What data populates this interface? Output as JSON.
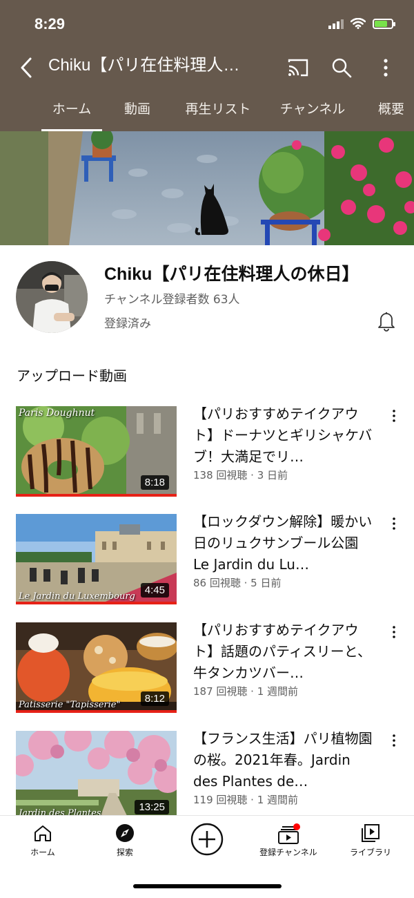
{
  "status": {
    "time": "8:29"
  },
  "appbar": {
    "title": "Chiku【パリ在住料理人…",
    "icons": [
      "back-icon",
      "cast-icon",
      "search-icon",
      "more-vert-icon"
    ]
  },
  "tabs": [
    {
      "label": "ホーム",
      "active": true
    },
    {
      "label": "動画",
      "active": false
    },
    {
      "label": "再生リスト",
      "active": false
    },
    {
      "label": "チャンネル",
      "active": false
    },
    {
      "label": "概要",
      "active": false
    }
  ],
  "channel": {
    "name": "Chiku【パリ在住料理人の休日】",
    "subscribers": "チャンネル登録者数 63人",
    "subscribed_label": "登録済み"
  },
  "section_title": "アップロード動画",
  "videos": [
    {
      "title": "【パリおすすめテイクアウト】ドーナツとギリシャケバブ！大満足でリ…",
      "meta": "138 回視聴 · 3 日前",
      "duration": "8:18",
      "thumb_text": "Paris Doughnut",
      "thumb_text2": ""
    },
    {
      "title": "【ロックダウン解除】暖かい日のリュクサンブール公園 Le Jardin du Lu…",
      "meta": "86 回視聴 · 5 日前",
      "duration": "4:45",
      "thumb_text": "",
      "thumb_text2": "Le Jardin du Luxembourg"
    },
    {
      "title": "【パリおすすめテイクアウト】話題のパティスリーと、牛タンカツバー…",
      "meta": "187 回視聴 · 1 週間前",
      "duration": "8:12",
      "thumb_text": "",
      "thumb_text2": "Patisserie \"Tapisserie\""
    },
    {
      "title": "【フランス生活】パリ植物園の桜。2021年春。Jardin des Plantes de…",
      "meta": "119 回視聴 · 1 週間前",
      "duration": "13:25",
      "thumb_text": "",
      "thumb_text2": "Jardin des Plantes"
    }
  ],
  "bottom_nav": [
    {
      "label": "ホーム",
      "icon": "home-icon"
    },
    {
      "label": "探索",
      "icon": "explore-icon"
    },
    {
      "label": "",
      "icon": "create-icon"
    },
    {
      "label": "登録チャンネル",
      "icon": "subscriptions-icon"
    },
    {
      "label": "ライブラリ",
      "icon": "library-icon"
    }
  ],
  "colors": {
    "header_bg": "#66594d",
    "progress": "#e62117",
    "notify_dot": "#ff0000"
  }
}
